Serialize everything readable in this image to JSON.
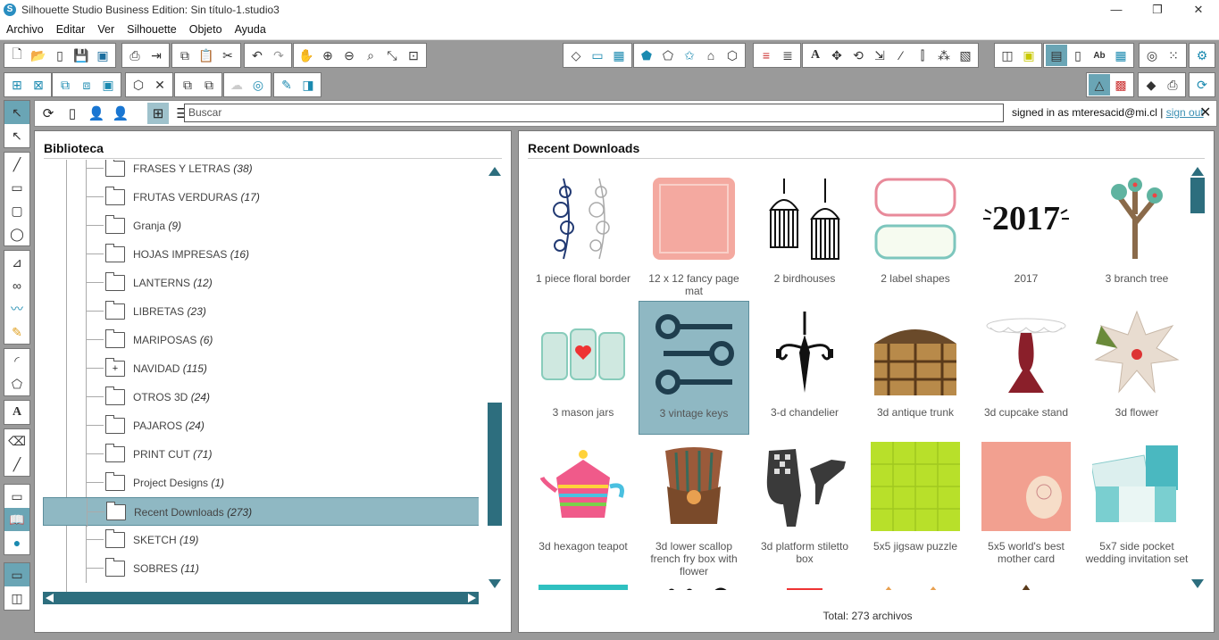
{
  "window": {
    "title": "Silhouette Studio Business Edition: Sin título-1.studio3",
    "minimize": "—",
    "maximize": "❐",
    "close": "✕"
  },
  "menu": [
    "Archivo",
    "Editar",
    "Ver",
    "Silhouette",
    "Objeto",
    "Ayuda"
  ],
  "toolbar": {
    "row1_left": [
      "new-doc-icon",
      "open-icon",
      "open-library-icon",
      "save-icon",
      "save-library-icon",
      "print-icon",
      "send-icon",
      "copy-icon",
      "paste-icon",
      "cut-icon",
      "undo-icon",
      "redo-icon",
      "pan-icon",
      "zoom-in-icon",
      "zoom-out-icon",
      "zoom-select-icon",
      "zoom-fit-icon",
      "fit-page-icon"
    ],
    "row1_right": [
      "eraser-icon",
      "page-setup-icon",
      "grid-icon",
      "fill-icon",
      "gradient-icon",
      "pattern-icon",
      "line-color-icon",
      "shadow-icon",
      "line-style-icon",
      "line-weight-icon",
      "text-style-icon",
      "transform-icon",
      "rotate-icon",
      "scale-icon",
      "shear-icon",
      "align-icon",
      "replicate-icon",
      "nest-icon",
      "offset-icon",
      "trace-icon",
      "library-icon",
      "store-icon",
      "text-icon",
      "layers-icon",
      "cut-settings-icon",
      "send-to-icon",
      "settings-icon"
    ]
  },
  "subbar": {
    "search_placeholder": "Buscar",
    "signed_in_text": "signed in as mteresacid@mi.cl |",
    "sign_out": "sign out"
  },
  "library": {
    "title": "Biblioteca",
    "folders": [
      {
        "name": "FRASES Y LETRAS",
        "count": "(38)"
      },
      {
        "name": "FRUTAS VERDURAS",
        "count": "(17)"
      },
      {
        "name": "Granja",
        "count": "(9)"
      },
      {
        "name": "HOJAS IMPRESAS",
        "count": "(16)"
      },
      {
        "name": "LANTERNS",
        "count": "(12)"
      },
      {
        "name": "LIBRETAS",
        "count": "(23)"
      },
      {
        "name": "MARIPOSAS",
        "count": "(6)"
      },
      {
        "name": "NAVIDAD",
        "count": "(115)",
        "expandable": true
      },
      {
        "name": "OTROS 3D",
        "count": "(24)"
      },
      {
        "name": "PAJAROS",
        "count": "(24)"
      },
      {
        "name": "PRINT CUT",
        "count": "(71)"
      },
      {
        "name": "Project Designs",
        "count": "(1)"
      },
      {
        "name": "Recent Downloads",
        "count": "(273)",
        "selected": true
      },
      {
        "name": "SKETCH",
        "count": "(19)"
      },
      {
        "name": "SOBRES",
        "count": "(11)"
      }
    ]
  },
  "downloads": {
    "title": "Recent Downloads",
    "items": [
      "1 piece floral border",
      "12 x 12 fancy page mat",
      "2 birdhouses",
      "2 label shapes",
      "2017",
      "3 branch tree",
      "3 mason jars",
      "3 vintage keys",
      "3-d chandelier",
      "3d antique trunk",
      "3d cupcake stand",
      "3d flower",
      "3d hexagon teapot",
      "3d lower scallop french fry box with flower",
      "3d platform stiletto box",
      "5x5 jigsaw puzzle",
      "5x5 world's best mother card",
      "5x7 side pocket wedding invitation set"
    ],
    "selected_index": 7,
    "total": "Total: 273 archivos",
    "art_text_2017": "2017"
  }
}
